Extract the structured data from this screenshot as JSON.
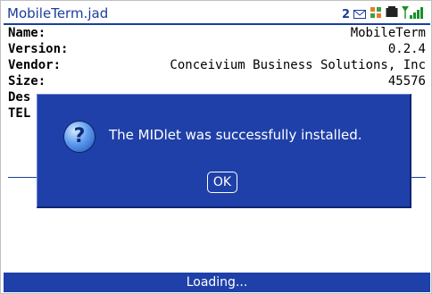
{
  "window": {
    "title": "MobileTerm.jad"
  },
  "status": {
    "unread_count": "2",
    "icons": [
      "envelope-icon",
      "data-connection-icon",
      "battery-icon",
      "signal-icon"
    ]
  },
  "details": [
    {
      "label": "Name:",
      "value": "MobileTerm"
    },
    {
      "label": "Version:",
      "value": "0.2.4"
    },
    {
      "label": "Vendor:",
      "value": "Conceivium Business Solutions, Inc"
    },
    {
      "label": "Size:",
      "value": "45576"
    },
    {
      "label": "Des",
      "value": ""
    },
    {
      "label": "TEL",
      "value": ""
    }
  ],
  "dialog": {
    "icon": "question-icon",
    "message": "The MIDlet was successfully installed.",
    "ok_label": "OK"
  },
  "footer": {
    "status_text": "Loading..."
  },
  "colors": {
    "accent": "#1f40a8",
    "title_text": "#1b3e9c"
  }
}
